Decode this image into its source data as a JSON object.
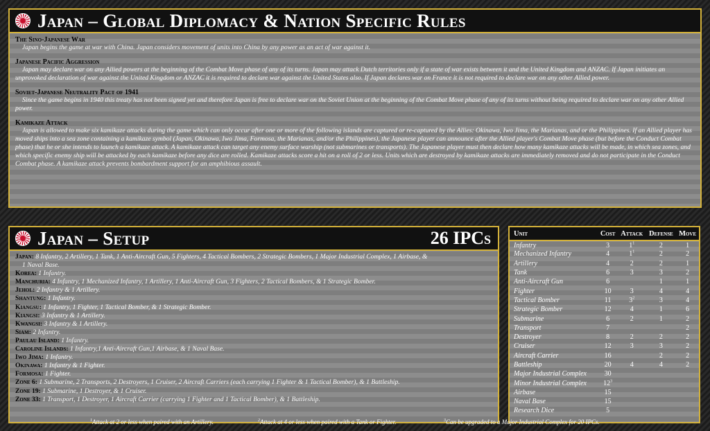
{
  "rules": {
    "title": "Japan – Global Diplomacy & Nation Specific Rules",
    "sections": [
      {
        "title": "The Sino-Japanese War",
        "text": "Japan begins the game at war with China. Japan considers movement of units into China by any power as an act of war against it."
      },
      {
        "title": "Japanese Pacific Aggression",
        "text": "Japan may declare war on any Allied powers at the beginning of the Combat Move phase of any of its turns. Japan may attack Dutch territories only if a state of war exists between it and the United Kingdom and ANZAC. If Japan initiates an unprovoked declaration of war against the United Kingdom or ANZAC it is required to declare war against the United States also. If Japan declares war on France it is not required to declare war on any other Allied power."
      },
      {
        "title": "Soviet-Japanese Neutrality Pact of 1941",
        "text": "Since the game begins in 1940 this treaty has not been signed yet and therefore Japan is free to declare war on the Soviet Union at the beginning of the Combat Move phase of any of its turns without being required to declare war on any other Allied power."
      },
      {
        "title": "Kamikaze Attack",
        "text": "Japan is allowed to make six kamikaze attacks during the game which can only occur after one or more of the following islands are captured or re-captured by the Allies: Okinawa, Iwo Jima, the Marianas, and or the Philippines. If an Allied player has moved ships into a sea zone containing a kamikaze symbol (Japan, Okinawa, Iwo Jima, Formosa, the Marianas, and/or the Philippines), the Japanese player can announce after the Allied player's Combat Move phase (but before the Conduct Combat phase) that he or she intends to launch a kamikaze attack. A kamikaze attack can target any enemy surface warship (not submarines or transports). The Japanese player must then declare how many kamikaze attacks will be made, in which sea zones, and which specific enemy ship will be attacked by each kamikaze before any dice are rolled. Kamikaze attacks score a hit on a roll of 2 or less. Units which are destroyed by kamikaze attacks are immediately removed and do not participate in the Conduct Combat phase. A kamikaze attack prevents bombardment support for an amphibious assault."
      }
    ]
  },
  "setup": {
    "title": "Japan – Setup",
    "ipcs": "26 IPCs",
    "rows": [
      {
        "loc": "Japan:",
        "units": "8 Infantry, 2 Artillery, 1 Tank, 1 Anti-Aircraft Gun, 5 Fighters, 4 Tactical Bombers, 2 Strategic Bombers, 1 Major Industrial Complex, 1 Airbase, &",
        "cont": "1 Naval Base."
      },
      {
        "loc": "Korea:",
        "units": "1 Infantry."
      },
      {
        "loc": "Manchuria:",
        "units": "4 Infantry, 1 Mechanized Infantry, 1 Artillery, 1 Anti-Aircraft Gun, 3 Fighters, 2 Tactical Bombers, & 1 Strategic Bomber."
      },
      {
        "loc": "Jehol:",
        "units": "2 Infantry & 1 Artillery."
      },
      {
        "loc": "Shantung:",
        "units": "1 Infantry."
      },
      {
        "loc": "Kiangsu:",
        "units": "1 Infantry, 1 Fighter, 1 Tactical Bomber, & 1 Strategic Bomber."
      },
      {
        "loc": "Kiangsi:",
        "units": "3 Infantry & 1 Artillery."
      },
      {
        "loc": "Kwangsi:",
        "units": "3 Infantry & 1 Artillery."
      },
      {
        "loc": "Siam:",
        "units": "2 Infantry."
      },
      {
        "loc": "Paulau Island:",
        "units": "1 Infantry."
      },
      {
        "loc": "Caroline Islands:",
        "units": "1 Infantry,1 Anti-Aircraft Gun,1 Airbase, & 1 Naval Base."
      },
      {
        "loc": "Iwo Jima:",
        "units": "1 Infantry."
      },
      {
        "loc": "Okinawa:",
        "units": "1 Infantry & 1 Fighter."
      },
      {
        "loc": "Formosa:",
        "units": "1 Fighter."
      },
      {
        "loc": "Zone 6:",
        "units": "1 Submarine, 2 Transports, 2 Destroyers, 1 Cruiser, 2 Aircraft Carriers (each carrying 1 Fighter & 1 Tactical Bomber), & 1 Battleship."
      },
      {
        "loc": "Zone 19:",
        "units": "1 Submarine, 1 Destroyer, & 1 Cruiser."
      },
      {
        "loc": "Zone 33:",
        "units": "1 Transport, 1 Destroyer, 1 Aircraft Carrier (carrying 1 Fighter and 1 Tactical Bomber), & 1 Battleship."
      }
    ]
  },
  "units_table": {
    "headers": {
      "unit": "Unit",
      "cost": "Cost",
      "attack": "Attack",
      "defense": "Defense",
      "move": "Move"
    },
    "rows": [
      {
        "name": "Infantry",
        "cost": "3",
        "attack": "1",
        "attack_sup": "1",
        "defense": "2",
        "move": "1"
      },
      {
        "name": "Mechanized Infantry",
        "cost": "4",
        "attack": "1",
        "attack_sup": "1",
        "defense": "2",
        "move": "2"
      },
      {
        "name": "Artillery",
        "cost": "4",
        "attack": "2",
        "attack_sup": "",
        "defense": "2",
        "move": "1"
      },
      {
        "name": "Tank",
        "cost": "6",
        "attack": "3",
        "attack_sup": "",
        "defense": "3",
        "move": "2"
      },
      {
        "name": "Anti-Aircraft Gun",
        "cost": "6",
        "attack": "",
        "attack_sup": "",
        "defense": "1",
        "move": "1"
      },
      {
        "name": "Fighter",
        "cost": "10",
        "attack": "3",
        "attack_sup": "",
        "defense": "4",
        "move": "4"
      },
      {
        "name": "Tactical Bomber",
        "cost": "11",
        "attack": "3",
        "attack_sup": "2",
        "defense": "3",
        "move": "4"
      },
      {
        "name": "Strategic Bomber",
        "cost": "12",
        "attack": "4",
        "attack_sup": "",
        "defense": "1",
        "move": "6"
      },
      {
        "name": "Submarine",
        "cost": "6",
        "attack": "2",
        "attack_sup": "",
        "defense": "1",
        "move": "2"
      },
      {
        "name": "Transport",
        "cost": "7",
        "attack": "",
        "attack_sup": "",
        "defense": "",
        "move": "2"
      },
      {
        "name": "Destroyer",
        "cost": "8",
        "attack": "2",
        "attack_sup": "",
        "defense": "2",
        "move": "2"
      },
      {
        "name": "Cruiser",
        "cost": "12",
        "attack": "3",
        "attack_sup": "",
        "defense": "3",
        "move": "2"
      },
      {
        "name": "Aircraft Carrier",
        "cost": "16",
        "attack": "",
        "attack_sup": "",
        "defense": "2",
        "move": "2"
      },
      {
        "name": "Battleship",
        "cost": "20",
        "attack": "4",
        "attack_sup": "",
        "defense": "4",
        "move": "2"
      },
      {
        "name": "Major Industrial Complex",
        "cost": "30",
        "cost_sup": "",
        "attack": "",
        "attack_sup": "",
        "defense": "",
        "move": ""
      },
      {
        "name": "Minor Industrial Complex",
        "cost": "12",
        "cost_sup": "3",
        "attack": "",
        "attack_sup": "",
        "defense": "",
        "move": ""
      },
      {
        "name": "Airbase",
        "cost": "15",
        "attack": "",
        "attack_sup": "",
        "defense": "",
        "move": ""
      },
      {
        "name": "Naval Base",
        "cost": "15",
        "attack": "",
        "attack_sup": "",
        "defense": "",
        "move": ""
      },
      {
        "name": "Research Dice",
        "cost": "5",
        "attack": "",
        "attack_sup": "",
        "defense": "",
        "move": ""
      }
    ]
  },
  "footnotes": [
    {
      "mark": "1",
      "text": "Attack at 2 or less when paired with an Artillery."
    },
    {
      "mark": "2",
      "text": "Attack at 4 or less when paired with a Tank or Fighter."
    },
    {
      "mark": "3",
      "text": "Can be upgraded to a Major Industrial Complex for 20 IPCs."
    }
  ]
}
